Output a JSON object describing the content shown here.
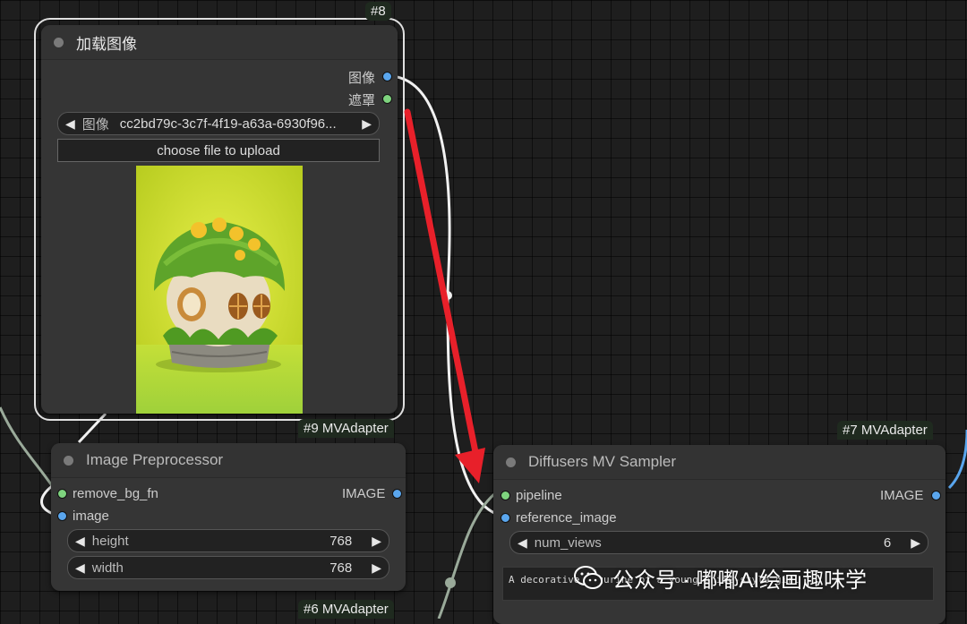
{
  "load_image_node": {
    "id_badge": "#8",
    "title": "加载图像",
    "outputs": [
      "图像",
      "遮罩"
    ],
    "image_widget": {
      "label": "图像",
      "value": "cc2bd79c-3c7f-4f19-a63a-6930f96..."
    },
    "upload_label": "choose file to upload"
  },
  "image_preprocessor_node": {
    "top_badge": "#9 MVAdapter",
    "title": "Image Preprocessor",
    "inputs": [
      "remove_bg_fn",
      "image"
    ],
    "output": "IMAGE",
    "widgets": [
      {
        "label": "height",
        "value": "768"
      },
      {
        "label": "width",
        "value": "768"
      }
    ],
    "bottom_badge": "#6 MVAdapter"
  },
  "sampler_node": {
    "top_badge": "#7 MVAdapter",
    "title": "Diffusers MV Sampler",
    "inputs": [
      "pipeline",
      "reference_image"
    ],
    "output": "IMAGE",
    "widget": {
      "label": "num_views",
      "value": "6"
    },
    "prompt": "A decorative figurine of a young anime-style girl"
  },
  "watermark": {
    "text": "公众号 · 嘟嘟AI绘画趣味学"
  },
  "colors": {
    "image_pin": "#5aa6ee",
    "mask_pin": "#7ed37e",
    "arrow": "#e8202a",
    "selection_outline": "#e0e0e0"
  }
}
